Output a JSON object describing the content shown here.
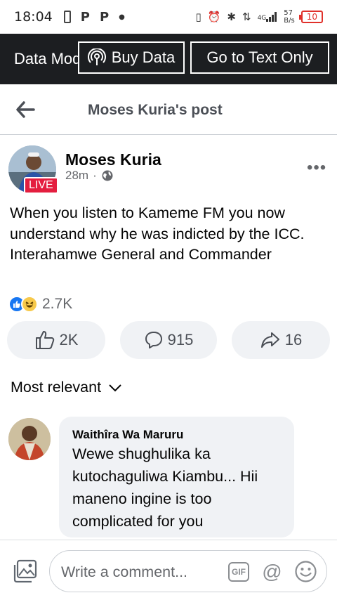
{
  "status_bar": {
    "time": "18:04",
    "network": "4G",
    "speed_value": "57",
    "speed_unit": "B/s",
    "battery": "10"
  },
  "data_bar": {
    "label": "Data Mode",
    "buy_data": "Buy Data",
    "text_only": "Go to Text Only"
  },
  "header": {
    "title": "Moses Kuria's post"
  },
  "post": {
    "author": "Moses Kuria",
    "live_label": "LIVE",
    "time": "28m",
    "text": "When you listen to Kameme FM you now understand why he was indicted by the ICC. Interahamwe General and Commander",
    "reaction_count": "2.7K",
    "likes": "2K",
    "comments": "915",
    "shares": "16"
  },
  "comments_section": {
    "sort_label": "Most relevant",
    "items": [
      {
        "author": "Waithîra Wa Maruru",
        "text": "Wewe shughulika ka kutochaguliwa Kiambu... Hii maneno ingine is too complicated for you"
      }
    ]
  },
  "composer": {
    "placeholder": "Write a comment...",
    "gif_label": "GIF"
  },
  "colors": {
    "data_bar_bg": "#1c1e21",
    "like_blue": "#1877f2",
    "live_red": "#e41e3f",
    "battery_red": "#e0312b"
  },
  "icons": [
    "back-arrow-icon",
    "broadcast-icon",
    "globe-icon",
    "more-dots-icon",
    "thumbs-up-icon",
    "comment-icon",
    "share-icon",
    "chevron-down-icon",
    "photo-icon",
    "gif-icon",
    "mention-icon",
    "emoji-icon"
  ]
}
